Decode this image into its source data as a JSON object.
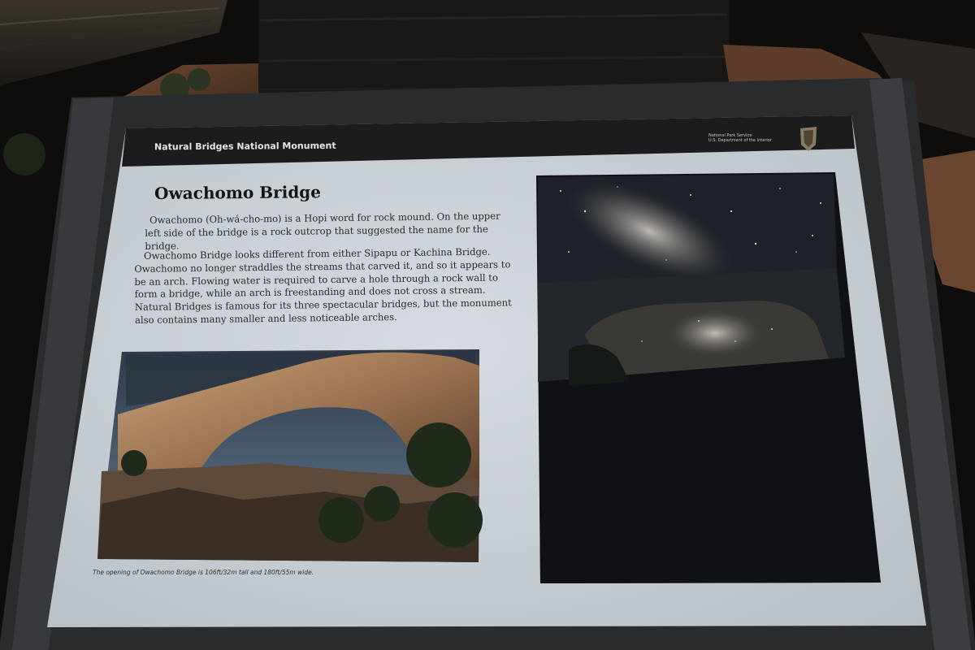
{
  "sign": {
    "header": "Natural Bridges National Monument",
    "agency_lines": [
      "National Park Service",
      "U.S. Department of the Interior"
    ],
    "title": "Owachomo Bridge",
    "paragraph_1": "Owachomo (Oh-wá-cho-mo) is a Hopi word for rock mound. On the upper left side of the bridge is a rock outcrop that suggested the name for the bridge.",
    "paragraph_2": "Owachomo Bridge looks different from either Sipapu or Kachina Bridge. Owachomo no longer straddles the streams that carved it, and so it appears to be an arch. Flowing water is required to carve a hole through a rock wall to form a bridge, while an arch is freestanding and does not cross a stream. Natural Bridges is famous for its three spectacular bridges, but the monument also contains many smaller and less noticeable arches.",
    "caption": "The opening of Owachomo Bridge is 106ft/32m tall and 180ft/55m wide."
  },
  "colors": {
    "panel": "#c9d0d6",
    "header_band": "#1c1c1e",
    "frame": "#2a2b2d",
    "night_sky": "#0f1114"
  }
}
